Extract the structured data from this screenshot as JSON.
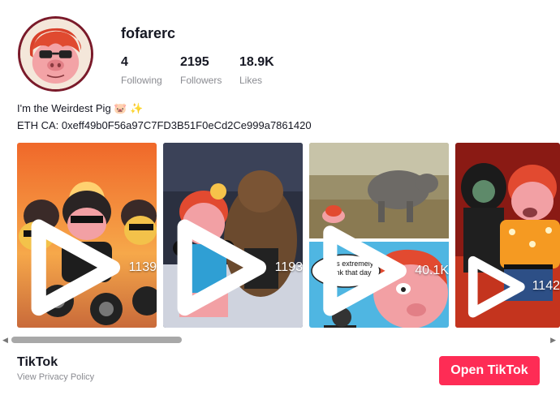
{
  "profile": {
    "username": "fofarerc",
    "stats": [
      {
        "value": "4",
        "label": "Following"
      },
      {
        "value": "2195",
        "label": "Followers"
      },
      {
        "value": "18.9K",
        "label": "Likes"
      }
    ],
    "bio_line1": "I'm the Weirdest Pig",
    "bio_emoji1": "🐷",
    "bio_emoji2": "✨",
    "bio_line2": "ETH CA: 0xeff49b0F56a97C7FD3B51F0eCd2Ce999a7861420"
  },
  "videos": [
    {
      "views": "1139"
    },
    {
      "views": "1193"
    },
    {
      "views": "40.1K",
      "caption": "I was extremely drunk that day"
    },
    {
      "views": "1142"
    }
  ],
  "footer": {
    "brand": "TikTok",
    "privacy": "View Privacy Policy",
    "open_button": "Open TikTok"
  },
  "colors": {
    "accent": "#fe2c55",
    "text": "#161823",
    "muted": "#8a8b91"
  }
}
